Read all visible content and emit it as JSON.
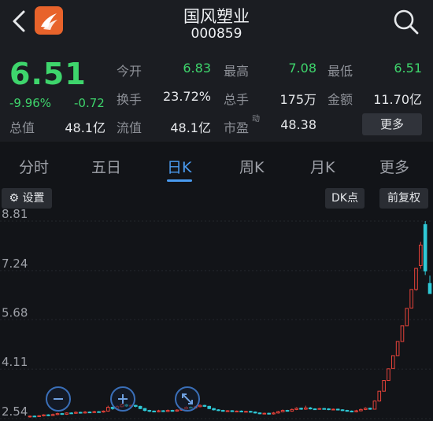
{
  "header": {
    "title": "国风塑业",
    "code": "000859"
  },
  "quote": {
    "price": "6.51",
    "change_pct": "-9.96%",
    "change": "-0.72",
    "fields": {
      "open_label": "今开",
      "open_value": "6.83",
      "high_label": "最高",
      "high_value": "7.08",
      "low_label": "最低",
      "low_value": "6.51",
      "turnover_label": "换手",
      "turnover_value": "23.72%",
      "volume_label": "总手",
      "volume_value": "175万",
      "amount_label": "金额",
      "amount_value": "11.70亿",
      "total_cap_label": "总值",
      "total_cap_value": "48.1亿",
      "float_cap_label": "流值",
      "float_cap_value": "48.1亿",
      "pe_label": "市盈",
      "pe_sup": "动",
      "pe_value": "48.38"
    },
    "more_label": "更多"
  },
  "tabs": [
    {
      "label": "分时"
    },
    {
      "label": "五日"
    },
    {
      "label": "日K",
      "active": true
    },
    {
      "label": "周K"
    },
    {
      "label": "月K"
    },
    {
      "label": "更多"
    }
  ],
  "chart_controls": {
    "settings_label": "设置",
    "dk_label": "DK点",
    "adjust_label": "前复权"
  },
  "colors": {
    "up": "#e8433a",
    "down": "#2fc9d6",
    "down_text": "#3ed56c",
    "accent": "#4a9bf0",
    "logo": "#e8632b"
  },
  "chart_data": {
    "type": "candlestick",
    "title": "",
    "y_ticks": [
      "8.81",
      "7.24",
      "5.68",
      "4.11",
      "2.54"
    ],
    "ylim": [
      2.54,
      8.81
    ],
    "candles": [
      {
        "o": 2.6,
        "c": 2.62,
        "h": 2.64,
        "l": 2.57
      },
      {
        "o": 2.62,
        "c": 2.61,
        "h": 2.64,
        "l": 2.59
      },
      {
        "o": 2.61,
        "c": 2.63,
        "h": 2.65,
        "l": 2.59
      },
      {
        "o": 2.63,
        "c": 2.66,
        "h": 2.68,
        "l": 2.61
      },
      {
        "o": 2.66,
        "c": 2.64,
        "h": 2.68,
        "l": 2.62
      },
      {
        "o": 2.64,
        "c": 2.67,
        "h": 2.7,
        "l": 2.62
      },
      {
        "o": 2.67,
        "c": 2.7,
        "h": 2.73,
        "l": 2.65
      },
      {
        "o": 2.7,
        "c": 2.68,
        "h": 2.72,
        "l": 2.66
      },
      {
        "o": 2.68,
        "c": 2.72,
        "h": 2.74,
        "l": 2.66
      },
      {
        "o": 2.72,
        "c": 2.71,
        "h": 2.74,
        "l": 2.69
      },
      {
        "o": 2.71,
        "c": 2.74,
        "h": 2.77,
        "l": 2.69
      },
      {
        "o": 2.74,
        "c": 2.72,
        "h": 2.76,
        "l": 2.7
      },
      {
        "o": 2.72,
        "c": 2.75,
        "h": 2.78,
        "l": 2.7
      },
      {
        "o": 2.75,
        "c": 2.74,
        "h": 2.77,
        "l": 2.72
      },
      {
        "o": 2.74,
        "c": 2.76,
        "h": 2.79,
        "l": 2.72
      },
      {
        "o": 2.76,
        "c": 2.75,
        "h": 2.78,
        "l": 2.73
      },
      {
        "o": 2.75,
        "c": 2.78,
        "h": 2.8,
        "l": 2.73
      },
      {
        "o": 2.78,
        "c": 2.9,
        "h": 2.95,
        "l": 2.76
      },
      {
        "o": 2.9,
        "c": 2.86,
        "h": 2.92,
        "l": 2.82
      },
      {
        "o": 2.86,
        "c": 2.92,
        "h": 2.96,
        "l": 2.84
      },
      {
        "o": 2.92,
        "c": 2.98,
        "h": 3.02,
        "l": 2.9
      },
      {
        "o": 2.98,
        "c": 2.94,
        "h": 3.01,
        "l": 2.91
      },
      {
        "o": 2.94,
        "c": 2.96,
        "h": 2.99,
        "l": 2.92
      },
      {
        "o": 2.96,
        "c": 2.93,
        "h": 2.98,
        "l": 2.9
      },
      {
        "o": 2.93,
        "c": 2.86,
        "h": 2.95,
        "l": 2.84
      },
      {
        "o": 2.86,
        "c": 2.8,
        "h": 2.88,
        "l": 2.77
      },
      {
        "o": 2.8,
        "c": 2.78,
        "h": 2.82,
        "l": 2.75
      },
      {
        "o": 2.78,
        "c": 2.76,
        "h": 2.8,
        "l": 2.74
      },
      {
        "o": 2.76,
        "c": 2.79,
        "h": 2.82,
        "l": 2.74
      },
      {
        "o": 2.79,
        "c": 2.77,
        "h": 2.81,
        "l": 2.75
      },
      {
        "o": 2.77,
        "c": 2.8,
        "h": 2.83,
        "l": 2.75
      },
      {
        "o": 2.8,
        "c": 2.78,
        "h": 2.82,
        "l": 2.76
      },
      {
        "o": 2.78,
        "c": 2.81,
        "h": 2.84,
        "l": 2.76
      },
      {
        "o": 2.81,
        "c": 2.85,
        "h": 2.88,
        "l": 2.79
      },
      {
        "o": 2.85,
        "c": 2.9,
        "h": 2.93,
        "l": 2.83
      },
      {
        "o": 2.9,
        "c": 2.88,
        "h": 2.93,
        "l": 2.86
      },
      {
        "o": 2.88,
        "c": 2.92,
        "h": 2.95,
        "l": 2.86
      },
      {
        "o": 2.92,
        "c": 2.96,
        "h": 2.99,
        "l": 2.9
      },
      {
        "o": 2.96,
        "c": 2.93,
        "h": 2.98,
        "l": 2.91
      },
      {
        "o": 2.93,
        "c": 2.86,
        "h": 2.95,
        "l": 2.84
      },
      {
        "o": 2.86,
        "c": 2.82,
        "h": 2.88,
        "l": 2.8
      },
      {
        "o": 2.82,
        "c": 2.8,
        "h": 2.84,
        "l": 2.78
      },
      {
        "o": 2.8,
        "c": 2.78,
        "h": 2.82,
        "l": 2.76
      },
      {
        "o": 2.78,
        "c": 2.79,
        "h": 2.81,
        "l": 2.76
      },
      {
        "o": 2.79,
        "c": 2.77,
        "h": 2.81,
        "l": 2.75
      },
      {
        "o": 2.77,
        "c": 2.78,
        "h": 2.8,
        "l": 2.75
      },
      {
        "o": 2.78,
        "c": 2.76,
        "h": 2.8,
        "l": 2.74
      },
      {
        "o": 2.76,
        "c": 2.77,
        "h": 2.79,
        "l": 2.74
      },
      {
        "o": 2.77,
        "c": 2.75,
        "h": 2.79,
        "l": 2.73
      },
      {
        "o": 2.75,
        "c": 2.72,
        "h": 2.77,
        "l": 2.7
      },
      {
        "o": 2.72,
        "c": 2.7,
        "h": 2.74,
        "l": 2.68
      },
      {
        "o": 2.7,
        "c": 2.71,
        "h": 2.73,
        "l": 2.68
      },
      {
        "o": 2.71,
        "c": 2.69,
        "h": 2.73,
        "l": 2.67
      },
      {
        "o": 2.69,
        "c": 2.72,
        "h": 2.75,
        "l": 2.67
      },
      {
        "o": 2.72,
        "c": 2.76,
        "h": 2.79,
        "l": 2.7
      },
      {
        "o": 2.76,
        "c": 2.8,
        "h": 2.83,
        "l": 2.74
      },
      {
        "o": 2.8,
        "c": 2.78,
        "h": 2.82,
        "l": 2.76
      },
      {
        "o": 2.78,
        "c": 2.83,
        "h": 2.86,
        "l": 2.76
      },
      {
        "o": 2.83,
        "c": 2.87,
        "h": 2.9,
        "l": 2.81
      },
      {
        "o": 2.87,
        "c": 2.84,
        "h": 2.89,
        "l": 2.82
      },
      {
        "o": 2.84,
        "c": 2.88,
        "h": 2.95,
        "l": 2.82
      },
      {
        "o": 2.88,
        "c": 2.85,
        "h": 2.91,
        "l": 2.83
      },
      {
        "o": 2.85,
        "c": 2.84,
        "h": 2.87,
        "l": 2.82
      },
      {
        "o": 2.84,
        "c": 2.86,
        "h": 2.88,
        "l": 2.82
      },
      {
        "o": 2.86,
        "c": 2.85,
        "h": 2.88,
        "l": 2.83
      },
      {
        "o": 2.85,
        "c": 2.83,
        "h": 2.87,
        "l": 2.81
      },
      {
        "o": 2.83,
        "c": 2.84,
        "h": 2.86,
        "l": 2.81
      },
      {
        "o": 2.84,
        "c": 2.82,
        "h": 2.86,
        "l": 2.8
      },
      {
        "o": 2.82,
        "c": 2.8,
        "h": 2.84,
        "l": 2.78
      },
      {
        "o": 2.8,
        "c": 2.78,
        "h": 2.82,
        "l": 2.76
      },
      {
        "o": 2.78,
        "c": 2.76,
        "h": 2.8,
        "l": 2.74
      },
      {
        "o": 2.76,
        "c": 2.79,
        "h": 2.82,
        "l": 2.74
      },
      {
        "o": 2.79,
        "c": 2.83,
        "h": 2.86,
        "l": 2.77
      },
      {
        "o": 2.83,
        "c": 2.87,
        "h": 2.9,
        "l": 2.81
      },
      {
        "o": 2.87,
        "c": 2.84,
        "h": 2.89,
        "l": 2.82
      },
      {
        "o": 2.84,
        "c": 3.1,
        "h": 3.12,
        "l": 2.83
      },
      {
        "o": 3.1,
        "c": 3.41,
        "h": 3.42,
        "l": 3.08
      },
      {
        "o": 3.41,
        "c": 3.75,
        "h": 3.76,
        "l": 3.4
      },
      {
        "o": 3.75,
        "c": 4.12,
        "h": 4.13,
        "l": 3.75
      },
      {
        "o": 4.13,
        "c": 4.54,
        "h": 4.55,
        "l": 4.13
      },
      {
        "o": 4.54,
        "c": 4.99,
        "h": 5.0,
        "l": 4.54
      },
      {
        "o": 4.99,
        "c": 5.49,
        "h": 5.5,
        "l": 4.99
      },
      {
        "o": 5.49,
        "c": 6.04,
        "h": 6.05,
        "l": 5.49
      },
      {
        "o": 6.05,
        "c": 6.64,
        "h": 6.65,
        "l": 6.05
      },
      {
        "o": 6.64,
        "c": 7.31,
        "h": 7.32,
        "l": 6.6
      },
      {
        "o": 7.4,
        "c": 8.05,
        "h": 8.15,
        "l": 7.3
      },
      {
        "o": 8.7,
        "c": 7.23,
        "h": 8.81,
        "l": 7.1
      },
      {
        "o": 6.83,
        "c": 6.51,
        "h": 7.08,
        "l": 6.51
      }
    ]
  }
}
